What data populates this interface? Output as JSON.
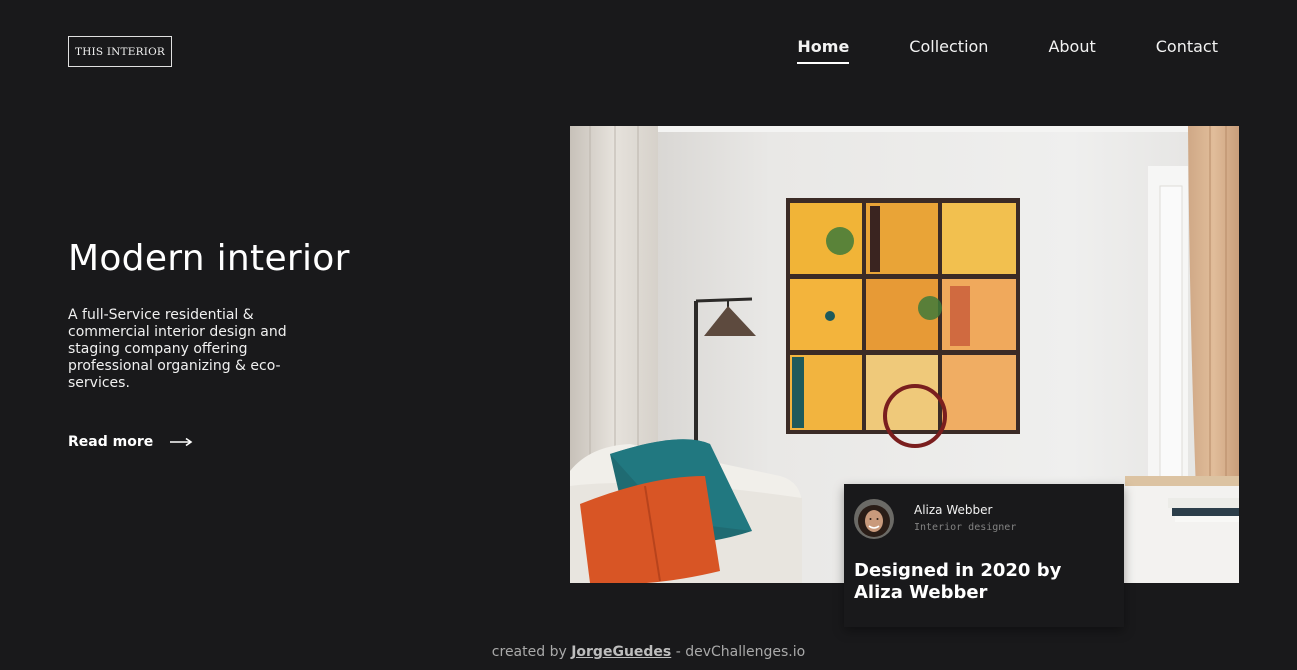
{
  "header": {
    "logo": "THIS INTERIOR",
    "nav": [
      {
        "label": "Home",
        "active": true
      },
      {
        "label": "Collection",
        "active": false
      },
      {
        "label": "About",
        "active": false
      },
      {
        "label": "Contact",
        "active": false
      }
    ]
  },
  "hero": {
    "title": "Modern interior",
    "description": "A full-Service residential & commercial interior design and staging company offering professional organizing & eco-services.",
    "read_more": "Read more",
    "read_more_icon": "arrow-right-icon"
  },
  "card": {
    "name": "Aliza Webber",
    "role": "Interior designer",
    "caption": "Designed in 2020 by Aliza Webber"
  },
  "footer": {
    "prefix": "created by ",
    "author": "JorgeGuedes",
    "suffix": " - devChallenges.io"
  },
  "colors": {
    "background": "#19191b",
    "text": "#ffffff",
    "muted": "#828282"
  }
}
